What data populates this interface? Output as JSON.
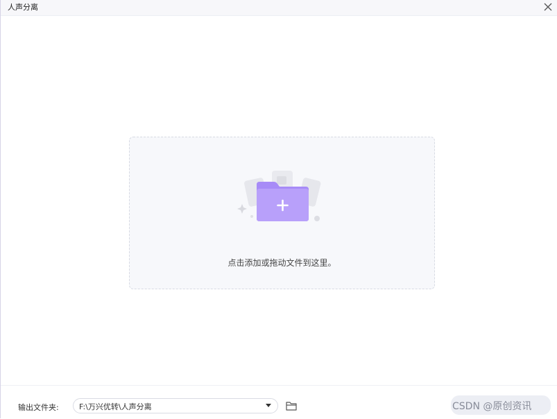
{
  "window": {
    "title": "人声分离"
  },
  "dropzone": {
    "hint": "点击添加或拖动文件到这里。"
  },
  "footer": {
    "output_label": "输出文件夹:",
    "output_path": "F:\\万兴优转\\人声分离"
  },
  "watermark": {
    "text": "CSDN @原创资讯"
  },
  "colors": {
    "accent_purple": "#9a7cf4",
    "border": "#d7dae3",
    "dropzone_bg": "#f7f8fb"
  },
  "icons": {
    "close": "close-icon",
    "add_folder": "add-folder-icon",
    "chevron": "chevron-down-icon",
    "browse": "folder-icon"
  }
}
